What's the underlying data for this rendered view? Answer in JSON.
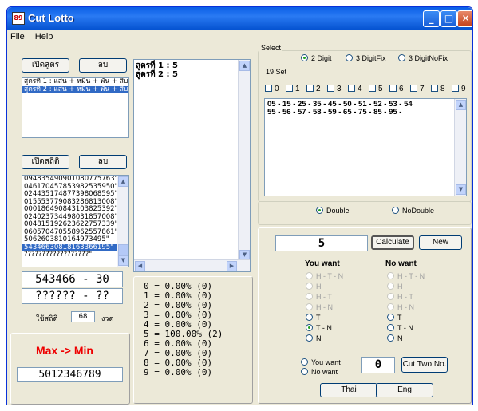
{
  "window": {
    "title": "Cut Lotto",
    "icon": "app-icon"
  },
  "menu": [
    "File",
    "Help"
  ],
  "left": {
    "open_formula_btn": "เปิดสูตร",
    "delete_btn": "ลบ",
    "formula_list": [
      "สูตรที่ 1 : แสน + หมื่น + พัน + สิบ +",
      "สูตรที่ 2 : แสน + หมื่น + พัน + สิบ +"
    ],
    "open_stats_btn": "เปิดสถิติ",
    "delete_btn2": "ลบ",
    "stats_list": [
      "094835490901080775763\"",
      "046170457853982535950\"",
      "024435174877398068595\"",
      "015553779083286813008\"",
      "000186490843103825392\"",
      "024023734498031857008\"",
      "004815192623622757339\"",
      "060570470558962557861\"",
      "5062603810164973495\"",
      "54346630818163366195\"",
      "??????????????????\""
    ],
    "result1": "543466 - 30",
    "result2": "?????? - ??",
    "use_stats_label": "ใช้สถิติ",
    "use_stats_value": "68",
    "period_label": "งวด",
    "max_min_label": "Max -> Min",
    "max_min_value": "5012346789"
  },
  "middle": {
    "formula_text": [
      "สูตรที่  1 : 5",
      "สูตรที่  2 : 5"
    ],
    "percent_lines": [
      "0 = 0.00% (0)",
      "1 = 0.00% (0)",
      "2 = 0.00% (0)",
      "3 = 0.00% (0)",
      "4 = 0.00% (0)",
      "5 = 100.00% (2)",
      "6 = 0.00% (0)",
      "7 = 0.00% (0)",
      "8 = 0.00% (0)",
      "9 = 0.00% (0)"
    ]
  },
  "right": {
    "select_label": "Select",
    "digit_options": [
      "2 Digit",
      "3 DigitFix",
      "3 DigitNoFix"
    ],
    "set_label": "19 Set",
    "set_digits": [
      "0",
      "1",
      "2",
      "3",
      "4",
      "5",
      "6",
      "7",
      "8",
      "9"
    ],
    "set_lines": [
      "05 - 15 - 25 - 35 - 45 - 50 - 51 - 52 - 53 - 54",
      "55 - 56 - 57 - 58 - 59 - 65 - 75 - 85 - 95 -"
    ],
    "double_options": [
      "Double",
      "NoDouble"
    ],
    "digit_value": "5",
    "calculate_btn": "Calculate",
    "new_btn": "New",
    "you_want_title": "You want",
    "no_want_title": "No want",
    "you_want_options": [
      "H - T - N",
      "H",
      "H - T",
      "H - N",
      "T",
      "T - N",
      "N"
    ],
    "no_want_options": [
      "H - T - N",
      "H",
      "H - T",
      "H - N",
      "T",
      "T - N",
      "N"
    ],
    "want_radio": [
      "You want",
      "No want"
    ],
    "cut_value": "0",
    "cut_btn": "Cut Two No.",
    "thai_btn": "Thai",
    "eng_btn": "Eng"
  }
}
